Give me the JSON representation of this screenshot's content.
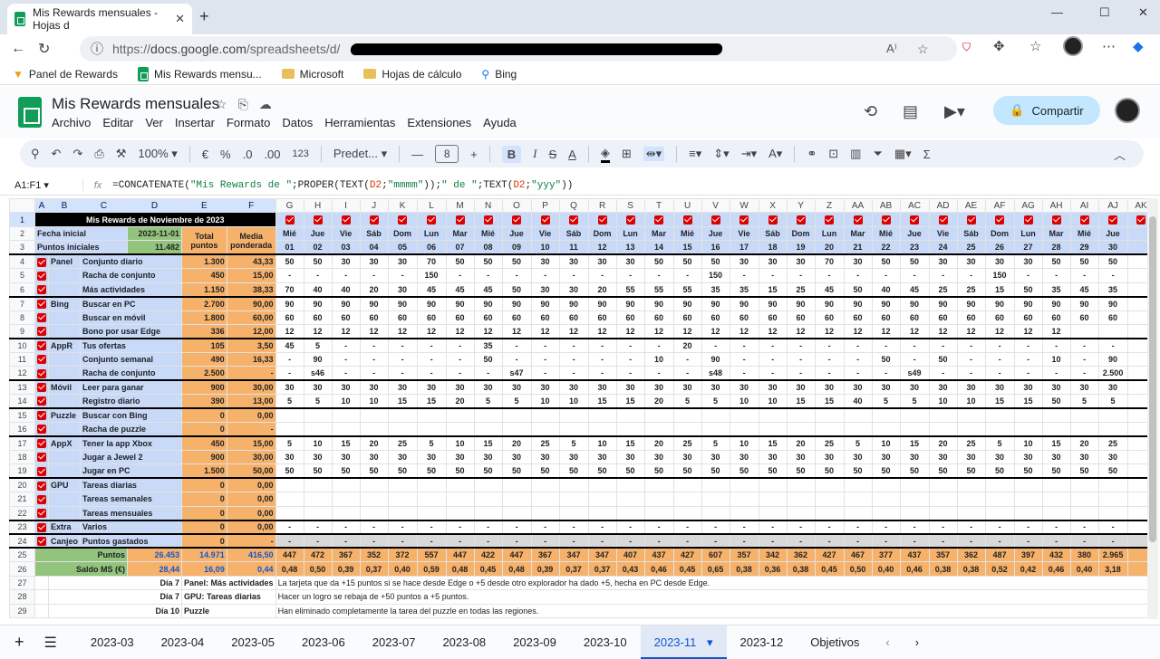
{
  "browser": {
    "tab_title": "Mis Rewards mensuales - Hojas d",
    "url_prefix": "https://",
    "url_host": "docs.google.com",
    "url_path": "/spreadsheets/d/"
  },
  "bookmarks": [
    "Panel de Rewards",
    "Mis Rewards mensu...",
    "Microsoft",
    "Hojas de cálculo",
    "Bing"
  ],
  "doc": {
    "title": "Mis Rewards mensuales",
    "menus": [
      "Archivo",
      "Editar",
      "Ver",
      "Insertar",
      "Formato",
      "Datos",
      "Herramientas",
      "Extensiones",
      "Ayuda"
    ],
    "share_label": "Compartir"
  },
  "toolbar": {
    "zoom": "100%",
    "currency": "€",
    "percent": "%",
    "dec_less": ".0",
    "dec_more": ".00",
    "numfmt": "123",
    "font": "Predet...",
    "font_size": "8"
  },
  "formula_bar": {
    "name_box": "A1:F1",
    "fx": "fx",
    "p1": "=CONCATENATE(",
    "s1": "\"Mis Rewards de \"",
    "p2": ";PROPER(TEXT(",
    "r1": "D2",
    "p3": ";",
    "s2": "\"mmmm\"",
    "p4": "));",
    "s3": "\" de \"",
    "p5": ";TEXT(",
    "r2": "D2",
    "p6": ";",
    "s4": "\"yyy\"",
    "p7": "))"
  },
  "columns": [
    "A",
    "B",
    "C",
    "D",
    "E",
    "F",
    "G",
    "H",
    "I",
    "J",
    "K",
    "L",
    "M",
    "N",
    "O",
    "P",
    "Q",
    "R",
    "S",
    "T",
    "U",
    "V",
    "W",
    "X",
    "Y",
    "Z",
    "AA",
    "AB",
    "AC",
    "AD",
    "AE",
    "AF",
    "AG",
    "AH",
    "AI",
    "AJ",
    "AK"
  ],
  "sheet": {
    "title": "Mis Rewards de Noviembre de 2023",
    "fecha_label": "Fecha inicial",
    "fecha_value": "2023-11-01",
    "puntos_label": "Puntos iniciales",
    "puntos_value": "11.482",
    "total_label": "Total puntos",
    "media_label": "Media ponderada",
    "weekdays": [
      "Mié",
      "Jue",
      "Vie",
      "Sáb",
      "Dom",
      "Lun",
      "Mar",
      "Mié",
      "Jue",
      "Vie",
      "Sáb",
      "Dom",
      "Lun",
      "Mar",
      "Mié",
      "Jue",
      "Vie",
      "Sáb",
      "Dom",
      "Lun",
      "Mar",
      "Mié",
      "Jue",
      "Vie",
      "Sáb",
      "Dom",
      "Lun",
      "Mar",
      "Mié",
      "Jue"
    ],
    "days": [
      "01",
      "02",
      "03",
      "04",
      "05",
      "06",
      "07",
      "08",
      "09",
      "10",
      "11",
      "12",
      "13",
      "14",
      "15",
      "16",
      "17",
      "18",
      "19",
      "20",
      "21",
      "22",
      "23",
      "24",
      "25",
      "26",
      "27",
      "28",
      "29",
      "30"
    ],
    "rows": [
      {
        "n": "4",
        "cat": "Panel",
        "name": "Conjunto diario",
        "total": "1.300",
        "media": "43,33",
        "d": [
          "50",
          "50",
          "30",
          "30",
          "30",
          "70",
          "50",
          "50",
          "50",
          "30",
          "30",
          "30",
          "30",
          "50",
          "50",
          "50",
          "30",
          "30",
          "30",
          "70",
          "30",
          "50",
          "50",
          "30",
          "30",
          "30",
          "30",
          "50",
          "50",
          "50"
        ]
      },
      {
        "n": "5",
        "cat": "",
        "name": "Racha de conjunto",
        "total": "450",
        "media": "15,00",
        "d": [
          "-",
          "-",
          "-",
          "-",
          "-",
          "150",
          "-",
          "-",
          "-",
          "-",
          "-",
          "-",
          "-",
          "-",
          "-",
          "150",
          "-",
          "-",
          "-",
          "-",
          "-",
          "-",
          "-",
          "-",
          "-",
          "150",
          "-",
          "-",
          "-",
          "-"
        ]
      },
      {
        "n": "6",
        "cat": "",
        "name": "Más actividades",
        "total": "1.150",
        "media": "38,33",
        "d": [
          "70",
          "40",
          "40",
          "20",
          "30",
          "45",
          "45",
          "45",
          "50",
          "30",
          "30",
          "20",
          "55",
          "55",
          "55",
          "35",
          "35",
          "15",
          "25",
          "45",
          "50",
          "40",
          "45",
          "25",
          "25",
          "15",
          "50",
          "35",
          "45",
          "35"
        ]
      },
      {
        "n": "7",
        "cat": "Bing",
        "name": "Buscar en PC",
        "total": "2.700",
        "media": "90,00",
        "d": [
          "90",
          "90",
          "90",
          "90",
          "90",
          "90",
          "90",
          "90",
          "90",
          "90",
          "90",
          "90",
          "90",
          "90",
          "90",
          "90",
          "90",
          "90",
          "90",
          "90",
          "90",
          "90",
          "90",
          "90",
          "90",
          "90",
          "90",
          "90",
          "90",
          "90"
        ]
      },
      {
        "n": "8",
        "cat": "",
        "name": "Buscar en móvil",
        "total": "1.800",
        "media": "60,00",
        "d": [
          "60",
          "60",
          "60",
          "60",
          "60",
          "60",
          "60",
          "60",
          "60",
          "60",
          "60",
          "60",
          "60",
          "60",
          "60",
          "60",
          "60",
          "60",
          "60",
          "60",
          "60",
          "60",
          "60",
          "60",
          "60",
          "60",
          "60",
          "60",
          "60",
          "60"
        ]
      },
      {
        "n": "9",
        "cat": "",
        "name": "Bono por usar Edge",
        "total": "336",
        "media": "12,00",
        "d": [
          "12",
          "12",
          "12",
          "12",
          "12",
          "12",
          "12",
          "12",
          "12",
          "12",
          "12",
          "12",
          "12",
          "12",
          "12",
          "12",
          "12",
          "12",
          "12",
          "12",
          "12",
          "12",
          "12",
          "12",
          "12",
          "12",
          "12",
          "12",
          "",
          ""
        ]
      },
      {
        "n": "10",
        "cat": "AppR",
        "name": "Tus ofertas",
        "total": "105",
        "media": "3,50",
        "d": [
          "45",
          "5",
          "-",
          "-",
          "-",
          "-",
          "-",
          "35",
          "-",
          "-",
          "-",
          "-",
          "-",
          "-",
          "20",
          "-",
          "-",
          "-",
          "-",
          "-",
          "-",
          "-",
          "-",
          "-",
          "-",
          "-",
          "-",
          "-",
          "-",
          "-"
        ]
      },
      {
        "n": "11",
        "cat": "",
        "name": "Conjunto semanal",
        "total": "490",
        "media": "16,33",
        "d": [
          "-",
          "90",
          "-",
          "-",
          "-",
          "-",
          "-",
          "50",
          "-",
          "-",
          "-",
          "-",
          "-",
          "10",
          "-",
          "90",
          "-",
          "-",
          "-",
          "-",
          "-",
          "50",
          "-",
          "50",
          "-",
          "-",
          "-",
          "10",
          "-",
          "90"
        ]
      },
      {
        "n": "12",
        "cat": "",
        "name": "Racha de conjunto",
        "total": "2.500",
        "media": "-",
        "d": [
          "-",
          "s46",
          "-",
          "-",
          "-",
          "-",
          "-",
          "-",
          "s47",
          "-",
          "-",
          "-",
          "-",
          "-",
          "-",
          "s48",
          "-",
          "-",
          "-",
          "-",
          "-",
          "-",
          "s49",
          "-",
          "-",
          "-",
          "-",
          "-",
          "-",
          "2.500"
        ]
      },
      {
        "n": "13",
        "cat": "Móvil",
        "name": "Leer para ganar",
        "total": "900",
        "media": "30,00",
        "d": [
          "30",
          "30",
          "30",
          "30",
          "30",
          "30",
          "30",
          "30",
          "30",
          "30",
          "30",
          "30",
          "30",
          "30",
          "30",
          "30",
          "30",
          "30",
          "30",
          "30",
          "30",
          "30",
          "30",
          "30",
          "30",
          "30",
          "30",
          "30",
          "30",
          "30"
        ]
      },
      {
        "n": "14",
        "cat": "",
        "name": "Registro diario",
        "total": "390",
        "media": "13,00",
        "d": [
          "5",
          "5",
          "10",
          "10",
          "15",
          "15",
          "20",
          "5",
          "5",
          "10",
          "10",
          "15",
          "15",
          "20",
          "5",
          "5",
          "10",
          "10",
          "15",
          "15",
          "40",
          "5",
          "5",
          "10",
          "10",
          "15",
          "15",
          "50",
          "5",
          "5"
        ]
      },
      {
        "n": "15",
        "cat": "Puzzle",
        "name": "Buscar con Bing",
        "total": "0",
        "media": "0,00",
        "d": []
      },
      {
        "n": "16",
        "cat": "",
        "name": "Racha de puzzle",
        "total": "0",
        "media": "-",
        "d": []
      },
      {
        "n": "17",
        "cat": "AppX",
        "name": "Tener la app Xbox",
        "total": "450",
        "media": "15,00",
        "d": [
          "5",
          "10",
          "15",
          "20",
          "25",
          "5",
          "10",
          "15",
          "20",
          "25",
          "5",
          "10",
          "15",
          "20",
          "25",
          "5",
          "10",
          "15",
          "20",
          "25",
          "5",
          "10",
          "15",
          "20",
          "25",
          "5",
          "10",
          "15",
          "20",
          "25"
        ]
      },
      {
        "n": "18",
        "cat": "",
        "name": "Jugar a Jewel 2",
        "total": "900",
        "media": "30,00",
        "d": [
          "30",
          "30",
          "30",
          "30",
          "30",
          "30",
          "30",
          "30",
          "30",
          "30",
          "30",
          "30",
          "30",
          "30",
          "30",
          "30",
          "30",
          "30",
          "30",
          "30",
          "30",
          "30",
          "30",
          "30",
          "30",
          "30",
          "30",
          "30",
          "30",
          "30"
        ]
      },
      {
        "n": "19",
        "cat": "",
        "name": "Jugar en PC",
        "total": "1.500",
        "media": "50,00",
        "d": [
          "50",
          "50",
          "50",
          "50",
          "50",
          "50",
          "50",
          "50",
          "50",
          "50",
          "50",
          "50",
          "50",
          "50",
          "50",
          "50",
          "50",
          "50",
          "50",
          "50",
          "50",
          "50",
          "50",
          "50",
          "50",
          "50",
          "50",
          "50",
          "50",
          "50"
        ]
      },
      {
        "n": "20",
        "cat": "GPU",
        "name": "Tareas diarias",
        "total": "0",
        "media": "0,00",
        "d": []
      },
      {
        "n": "21",
        "cat": "",
        "name": "Tareas semanales",
        "total": "0",
        "media": "0,00",
        "d": []
      },
      {
        "n": "22",
        "cat": "",
        "name": "Tareas mensuales",
        "total": "0",
        "media": "0,00",
        "d": []
      },
      {
        "n": "23",
        "cat": "Extra",
        "name": "Varios",
        "total": "0",
        "media": "0,00",
        "d": [
          "-",
          "-",
          "-",
          "-",
          "-",
          "-",
          "-",
          "-",
          "-",
          "-",
          "-",
          "-",
          "-",
          "-",
          "-",
          "-",
          "-",
          "-",
          "-",
          "-",
          "-",
          "-",
          "-",
          "-",
          "-",
          "-",
          "-",
          "-",
          "-",
          "-"
        ]
      },
      {
        "n": "24",
        "cat": "Canjeo",
        "name": "Puntos gastados",
        "total": "0",
        "media": "-",
        "d": [
          "-",
          "-",
          "-",
          "-",
          "-",
          "-",
          "-",
          "-",
          "-",
          "-",
          "-",
          "-",
          "-",
          "-",
          "-",
          "-",
          "-",
          "-",
          "-",
          "-",
          "-",
          "-",
          "-",
          "-",
          "-",
          "-",
          "-",
          "-",
          "-",
          "-"
        ]
      }
    ],
    "puntos": {
      "label": "Puntos",
      "d": "26.453",
      "e": "14.971",
      "f": "416,50",
      "vals": [
        "447",
        "472",
        "367",
        "352",
        "372",
        "557",
        "447",
        "422",
        "447",
        "367",
        "347",
        "347",
        "407",
        "437",
        "427",
        "607",
        "357",
        "342",
        "362",
        "427",
        "467",
        "377",
        "437",
        "357",
        "362",
        "487",
        "397",
        "432",
        "380",
        "2.965"
      ]
    },
    "saldo": {
      "label": "Saldo MS (€)",
      "d": "28,44",
      "e": "16,09",
      "f": "0,44",
      "vals": [
        "0,48",
        "0,50",
        "0,39",
        "0,37",
        "0,40",
        "0,59",
        "0,48",
        "0,45",
        "0,48",
        "0,39",
        "0,37",
        "0,37",
        "0,43",
        "0,46",
        "0,45",
        "0,65",
        "0,38",
        "0,36",
        "0,38",
        "0,45",
        "0,50",
        "0,40",
        "0,46",
        "0,38",
        "0,38",
        "0,52",
        "0,42",
        "0,46",
        "0,40",
        "3,18"
      ]
    },
    "notes": [
      {
        "n": "27",
        "day": "Día 7",
        "what": "Panel: Más actividades",
        "text": "La tarjeta que da +15 puntos si se hace desde Edge o +5 desde otro explorador ha dado +5, hecha en PC desde Edge."
      },
      {
        "n": "28",
        "day": "Día 7",
        "what": "GPU: Tareas diarias",
        "text": "Hacer un logro se rebaja de +50 puntos a +5 puntos."
      },
      {
        "n": "29",
        "day": "Día 10",
        "what": "Puzzle",
        "text": "Han eliminado completamente la tarea del puzzle en todas las regiones."
      }
    ]
  },
  "sheet_tabs": [
    "2023-03",
    "2023-04",
    "2023-05",
    "2023-06",
    "2023-07",
    "2023-08",
    "2023-09",
    "2023-10",
    "2023-11",
    "2023-12",
    "Objetivos"
  ],
  "active_tab": "2023-11"
}
